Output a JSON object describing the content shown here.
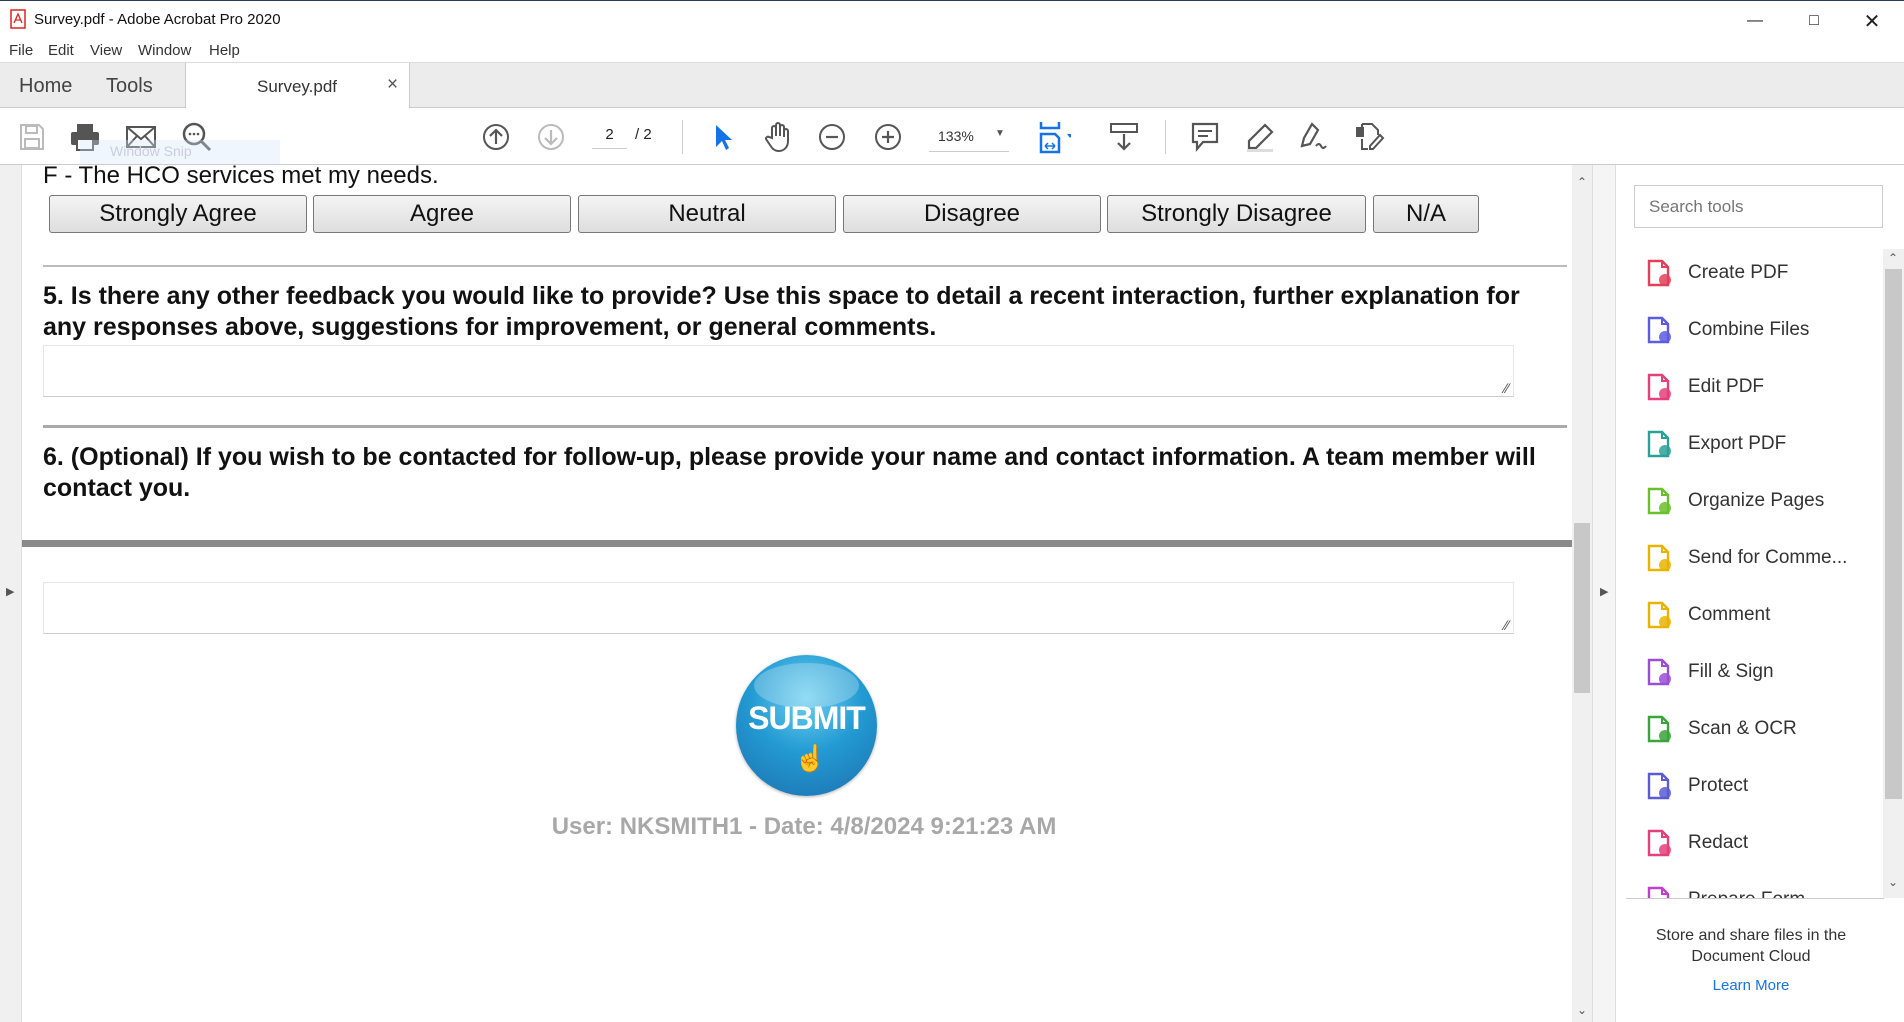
{
  "window": {
    "title": "Survey.pdf - Adobe Acrobat Pro 2020",
    "controls": [
      "minimize",
      "maximize",
      "close"
    ]
  },
  "menu": [
    "File",
    "Edit",
    "View",
    "Window",
    "Help"
  ],
  "tabs": {
    "home": "Home",
    "tools": "Tools",
    "document": "Survey.pdf",
    "close": "×"
  },
  "overlay": {
    "snip": "Window Snip"
  },
  "toolbar": {
    "page_current": "2",
    "page_total": "/ 2",
    "zoom": "133%"
  },
  "document": {
    "item_f": "F - The HCO services met my needs.",
    "options": [
      "Strongly Agree",
      "Agree",
      "Neutral",
      "Disagree",
      "Strongly Disagree",
      "N/A"
    ],
    "q5": "5. Is there any other feedback you would like to provide? Use this space to detail a recent interaction, further explanation for any responses above, suggestions for improvement, or general comments.",
    "q6": "6. (Optional) If you wish to be contacted for follow-up, please provide your name and contact information. A team member will contact you.",
    "submit_label": "SUBMIT",
    "user_line": "User: NKSMITH1 - Date: 4/8/2024 9:21:23 AM"
  },
  "right_panel": {
    "search_placeholder": "Search tools",
    "tools": [
      {
        "label": "Create PDF",
        "color": "#e4405a"
      },
      {
        "label": "Combine Files",
        "color": "#5c5ce0"
      },
      {
        "label": "Edit PDF",
        "color": "#e4407a"
      },
      {
        "label": "Export PDF",
        "color": "#2aa198"
      },
      {
        "label": "Organize Pages",
        "color": "#6abf2a"
      },
      {
        "label": "Send for Comme...",
        "color": "#e8b400"
      },
      {
        "label": "Comment",
        "color": "#e8b400"
      },
      {
        "label": "Fill & Sign",
        "color": "#9b4dd6"
      },
      {
        "label": "Scan & OCR",
        "color": "#3aa53a"
      },
      {
        "label": "Protect",
        "color": "#5b5bd6"
      },
      {
        "label": "Redact",
        "color": "#e4407a"
      },
      {
        "label": "Prepare Form",
        "color": "#c03fd0"
      }
    ],
    "cloud_text": "Store and share files in the Document Cloud",
    "learn_more": "Learn More"
  },
  "colors": {
    "accent": "#1473e6",
    "submit": "#1e8ec8"
  }
}
